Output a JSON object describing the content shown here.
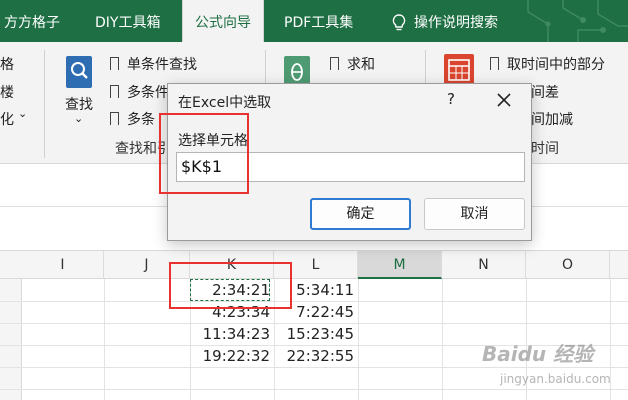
{
  "ribbon_tabs": {
    "t0": "方方格子",
    "t1": "DIY工具箱",
    "t2": "公式向导",
    "t3": "PDF工具集",
    "t4": "操作说明搜索"
  },
  "ribbon": {
    "left_partial": [
      "格",
      "楼",
      "化"
    ],
    "lookup_label": "查找",
    "items_col1": [
      "单条件查找",
      "多条件",
      "多条"
    ],
    "items_col2": [
      "求和"
    ],
    "items_col3": [
      "取时间中的部分",
      "间差",
      "间加减"
    ],
    "group_lookup": "查找和引",
    "group_time": "时间"
  },
  "dialog": {
    "title": "在Excel中选取",
    "help": "?",
    "label": "选择单元格",
    "value": "$K$1",
    "ok": "确定",
    "cancel": "取消"
  },
  "grid": {
    "columns": [
      "I",
      "J",
      "K",
      "L",
      "M",
      "N",
      "O"
    ],
    "selected_column": "M",
    "col_k": [
      "2:34:21",
      "4:23:34",
      "11:34:23",
      "19:22:32"
    ],
    "col_l": [
      "5:34:11",
      "7:22:45",
      "15:23:45",
      "22:32:55"
    ]
  },
  "watermark": {
    "brand": "Baidu 经验",
    "sub": "jingyan.baidu.com"
  },
  "colors": {
    "excel_green": "#1e6f43",
    "annotation_red": "#e8322f",
    "focus_blue": "#2e7bd1"
  }
}
